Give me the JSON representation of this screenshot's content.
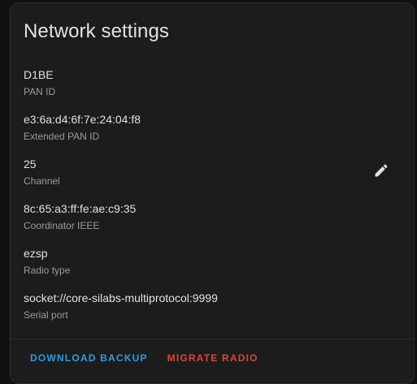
{
  "card": {
    "title": "Network settings",
    "fields": [
      {
        "value": "D1BE",
        "label": "PAN ID"
      },
      {
        "value": "e3:6a:d4:6f:7e:24:04:f8",
        "label": "Extended PAN ID"
      },
      {
        "value": "25",
        "label": "Channel"
      },
      {
        "value": "8c:65:a3:ff:fe:ae:c9:35",
        "label": "Coordinator IEEE"
      },
      {
        "value": "ezsp",
        "label": "Radio type"
      },
      {
        "value": "socket://core-silabs-multiprotocol:9999",
        "label": "Serial port"
      }
    ],
    "edit_icon": "pencil-icon",
    "actions": {
      "download_backup": "DOWNLOAD BACKUP",
      "migrate_radio": "MIGRATE RADIO"
    }
  },
  "colors": {
    "background": "#111111",
    "card": "#1c1c1c",
    "primary": "#2a9ee2",
    "danger": "#db4437",
    "text": "#e1e1e1",
    "secondary_text": "#9b9b9b"
  }
}
